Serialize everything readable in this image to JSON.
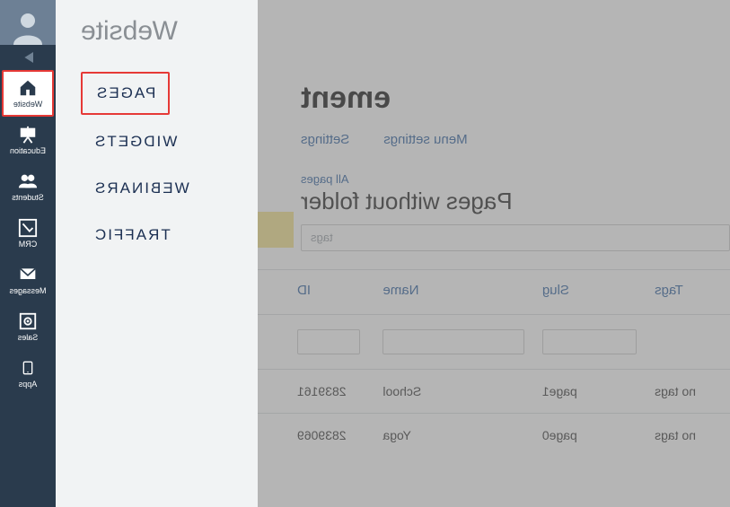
{
  "nav": {
    "items": [
      {
        "key": "website",
        "label": "Website",
        "active": true
      },
      {
        "key": "education",
        "label": "Education",
        "active": false
      },
      {
        "key": "students",
        "label": "Students",
        "active": false
      },
      {
        "key": "crm",
        "label": "CRM",
        "active": false
      },
      {
        "key": "messages",
        "label": "Messages",
        "active": false
      },
      {
        "key": "sales",
        "label": "Sales",
        "active": false
      },
      {
        "key": "apps",
        "label": "Apps",
        "active": false
      }
    ]
  },
  "secondary": {
    "title": "Website",
    "items": [
      {
        "label": "PAGES",
        "active": true
      },
      {
        "label": "WIDGETS",
        "active": false
      },
      {
        "label": "WEBINARS",
        "active": false
      },
      {
        "label": "TRAFFIC",
        "active": false
      }
    ]
  },
  "main": {
    "title_suffix": "ement",
    "tabs": {
      "settings": "Settings",
      "menu_settings": "Menu settings"
    },
    "breadcrumb": "All pages",
    "subtitle": "Pages without folder",
    "tags_placeholder": "tags",
    "columns": {
      "tags": "Tags",
      "slug": "Slug",
      "name": "Name",
      "id": "ID"
    },
    "rows": [
      {
        "id": "2839161",
        "name": "School",
        "slug": "page1",
        "tags": "no tags"
      },
      {
        "id": "2839069",
        "name": "Yoga",
        "slug": "page0",
        "tags": "no tags"
      }
    ]
  }
}
